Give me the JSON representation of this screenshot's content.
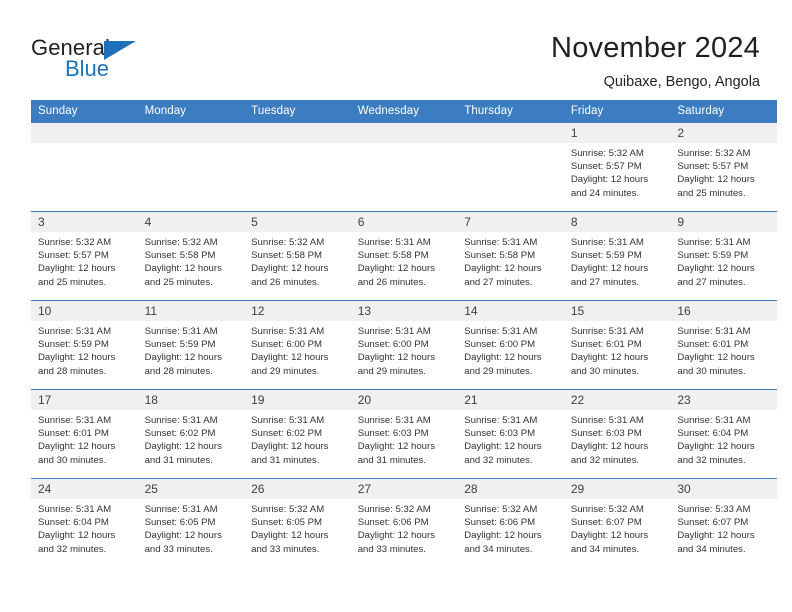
{
  "logo": {
    "word_primary": "General",
    "word_secondary": "Blue",
    "triangle_color": "#1c71b8",
    "primary_color": "#231f20",
    "secondary_color": "#1c75bc"
  },
  "header": {
    "title": "November 2024",
    "subtitle": "Quibaxe, Bengo, Angola",
    "accent_color": "#3b7dc0",
    "daynum_bg": "#f0f0f0"
  },
  "weekdays": [
    "Sunday",
    "Monday",
    "Tuesday",
    "Wednesday",
    "Thursday",
    "Friday",
    "Saturday"
  ],
  "weeks": [
    [
      {
        "day": "",
        "empty": true
      },
      {
        "day": "",
        "empty": true
      },
      {
        "day": "",
        "empty": true
      },
      {
        "day": "",
        "empty": true
      },
      {
        "day": "",
        "empty": true
      },
      {
        "day": "1",
        "sunrise": "Sunrise: 5:32 AM",
        "sunset": "Sunset: 5:57 PM",
        "daylight_line1": "Daylight: 12 hours",
        "daylight_line2": "and 24 minutes."
      },
      {
        "day": "2",
        "sunrise": "Sunrise: 5:32 AM",
        "sunset": "Sunset: 5:57 PM",
        "daylight_line1": "Daylight: 12 hours",
        "daylight_line2": "and 25 minutes."
      }
    ],
    [
      {
        "day": "3",
        "sunrise": "Sunrise: 5:32 AM",
        "sunset": "Sunset: 5:57 PM",
        "daylight_line1": "Daylight: 12 hours",
        "daylight_line2": "and 25 minutes."
      },
      {
        "day": "4",
        "sunrise": "Sunrise: 5:32 AM",
        "sunset": "Sunset: 5:58 PM",
        "daylight_line1": "Daylight: 12 hours",
        "daylight_line2": "and 25 minutes."
      },
      {
        "day": "5",
        "sunrise": "Sunrise: 5:32 AM",
        "sunset": "Sunset: 5:58 PM",
        "daylight_line1": "Daylight: 12 hours",
        "daylight_line2": "and 26 minutes."
      },
      {
        "day": "6",
        "sunrise": "Sunrise: 5:31 AM",
        "sunset": "Sunset: 5:58 PM",
        "daylight_line1": "Daylight: 12 hours",
        "daylight_line2": "and 26 minutes."
      },
      {
        "day": "7",
        "sunrise": "Sunrise: 5:31 AM",
        "sunset": "Sunset: 5:58 PM",
        "daylight_line1": "Daylight: 12 hours",
        "daylight_line2": "and 27 minutes."
      },
      {
        "day": "8",
        "sunrise": "Sunrise: 5:31 AM",
        "sunset": "Sunset: 5:59 PM",
        "daylight_line1": "Daylight: 12 hours",
        "daylight_line2": "and 27 minutes."
      },
      {
        "day": "9",
        "sunrise": "Sunrise: 5:31 AM",
        "sunset": "Sunset: 5:59 PM",
        "daylight_line1": "Daylight: 12 hours",
        "daylight_line2": "and 27 minutes."
      }
    ],
    [
      {
        "day": "10",
        "sunrise": "Sunrise: 5:31 AM",
        "sunset": "Sunset: 5:59 PM",
        "daylight_line1": "Daylight: 12 hours",
        "daylight_line2": "and 28 minutes."
      },
      {
        "day": "11",
        "sunrise": "Sunrise: 5:31 AM",
        "sunset": "Sunset: 5:59 PM",
        "daylight_line1": "Daylight: 12 hours",
        "daylight_line2": "and 28 minutes."
      },
      {
        "day": "12",
        "sunrise": "Sunrise: 5:31 AM",
        "sunset": "Sunset: 6:00 PM",
        "daylight_line1": "Daylight: 12 hours",
        "daylight_line2": "and 29 minutes."
      },
      {
        "day": "13",
        "sunrise": "Sunrise: 5:31 AM",
        "sunset": "Sunset: 6:00 PM",
        "daylight_line1": "Daylight: 12 hours",
        "daylight_line2": "and 29 minutes."
      },
      {
        "day": "14",
        "sunrise": "Sunrise: 5:31 AM",
        "sunset": "Sunset: 6:00 PM",
        "daylight_line1": "Daylight: 12 hours",
        "daylight_line2": "and 29 minutes."
      },
      {
        "day": "15",
        "sunrise": "Sunrise: 5:31 AM",
        "sunset": "Sunset: 6:01 PM",
        "daylight_line1": "Daylight: 12 hours",
        "daylight_line2": "and 30 minutes."
      },
      {
        "day": "16",
        "sunrise": "Sunrise: 5:31 AM",
        "sunset": "Sunset: 6:01 PM",
        "daylight_line1": "Daylight: 12 hours",
        "daylight_line2": "and 30 minutes."
      }
    ],
    [
      {
        "day": "17",
        "sunrise": "Sunrise: 5:31 AM",
        "sunset": "Sunset: 6:01 PM",
        "daylight_line1": "Daylight: 12 hours",
        "daylight_line2": "and 30 minutes."
      },
      {
        "day": "18",
        "sunrise": "Sunrise: 5:31 AM",
        "sunset": "Sunset: 6:02 PM",
        "daylight_line1": "Daylight: 12 hours",
        "daylight_line2": "and 31 minutes."
      },
      {
        "day": "19",
        "sunrise": "Sunrise: 5:31 AM",
        "sunset": "Sunset: 6:02 PM",
        "daylight_line1": "Daylight: 12 hours",
        "daylight_line2": "and 31 minutes."
      },
      {
        "day": "20",
        "sunrise": "Sunrise: 5:31 AM",
        "sunset": "Sunset: 6:03 PM",
        "daylight_line1": "Daylight: 12 hours",
        "daylight_line2": "and 31 minutes."
      },
      {
        "day": "21",
        "sunrise": "Sunrise: 5:31 AM",
        "sunset": "Sunset: 6:03 PM",
        "daylight_line1": "Daylight: 12 hours",
        "daylight_line2": "and 32 minutes."
      },
      {
        "day": "22",
        "sunrise": "Sunrise: 5:31 AM",
        "sunset": "Sunset: 6:03 PM",
        "daylight_line1": "Daylight: 12 hours",
        "daylight_line2": "and 32 minutes."
      },
      {
        "day": "23",
        "sunrise": "Sunrise: 5:31 AM",
        "sunset": "Sunset: 6:04 PM",
        "daylight_line1": "Daylight: 12 hours",
        "daylight_line2": "and 32 minutes."
      }
    ],
    [
      {
        "day": "24",
        "sunrise": "Sunrise: 5:31 AM",
        "sunset": "Sunset: 6:04 PM",
        "daylight_line1": "Daylight: 12 hours",
        "daylight_line2": "and 32 minutes."
      },
      {
        "day": "25",
        "sunrise": "Sunrise: 5:31 AM",
        "sunset": "Sunset: 6:05 PM",
        "daylight_line1": "Daylight: 12 hours",
        "daylight_line2": "and 33 minutes."
      },
      {
        "day": "26",
        "sunrise": "Sunrise: 5:32 AM",
        "sunset": "Sunset: 6:05 PM",
        "daylight_line1": "Daylight: 12 hours",
        "daylight_line2": "and 33 minutes."
      },
      {
        "day": "27",
        "sunrise": "Sunrise: 5:32 AM",
        "sunset": "Sunset: 6:06 PM",
        "daylight_line1": "Daylight: 12 hours",
        "daylight_line2": "and 33 minutes."
      },
      {
        "day": "28",
        "sunrise": "Sunrise: 5:32 AM",
        "sunset": "Sunset: 6:06 PM",
        "daylight_line1": "Daylight: 12 hours",
        "daylight_line2": "and 34 minutes."
      },
      {
        "day": "29",
        "sunrise": "Sunrise: 5:32 AM",
        "sunset": "Sunset: 6:07 PM",
        "daylight_line1": "Daylight: 12 hours",
        "daylight_line2": "and 34 minutes."
      },
      {
        "day": "30",
        "sunrise": "Sunrise: 5:33 AM",
        "sunset": "Sunset: 6:07 PM",
        "daylight_line1": "Daylight: 12 hours",
        "daylight_line2": "and 34 minutes."
      }
    ]
  ]
}
